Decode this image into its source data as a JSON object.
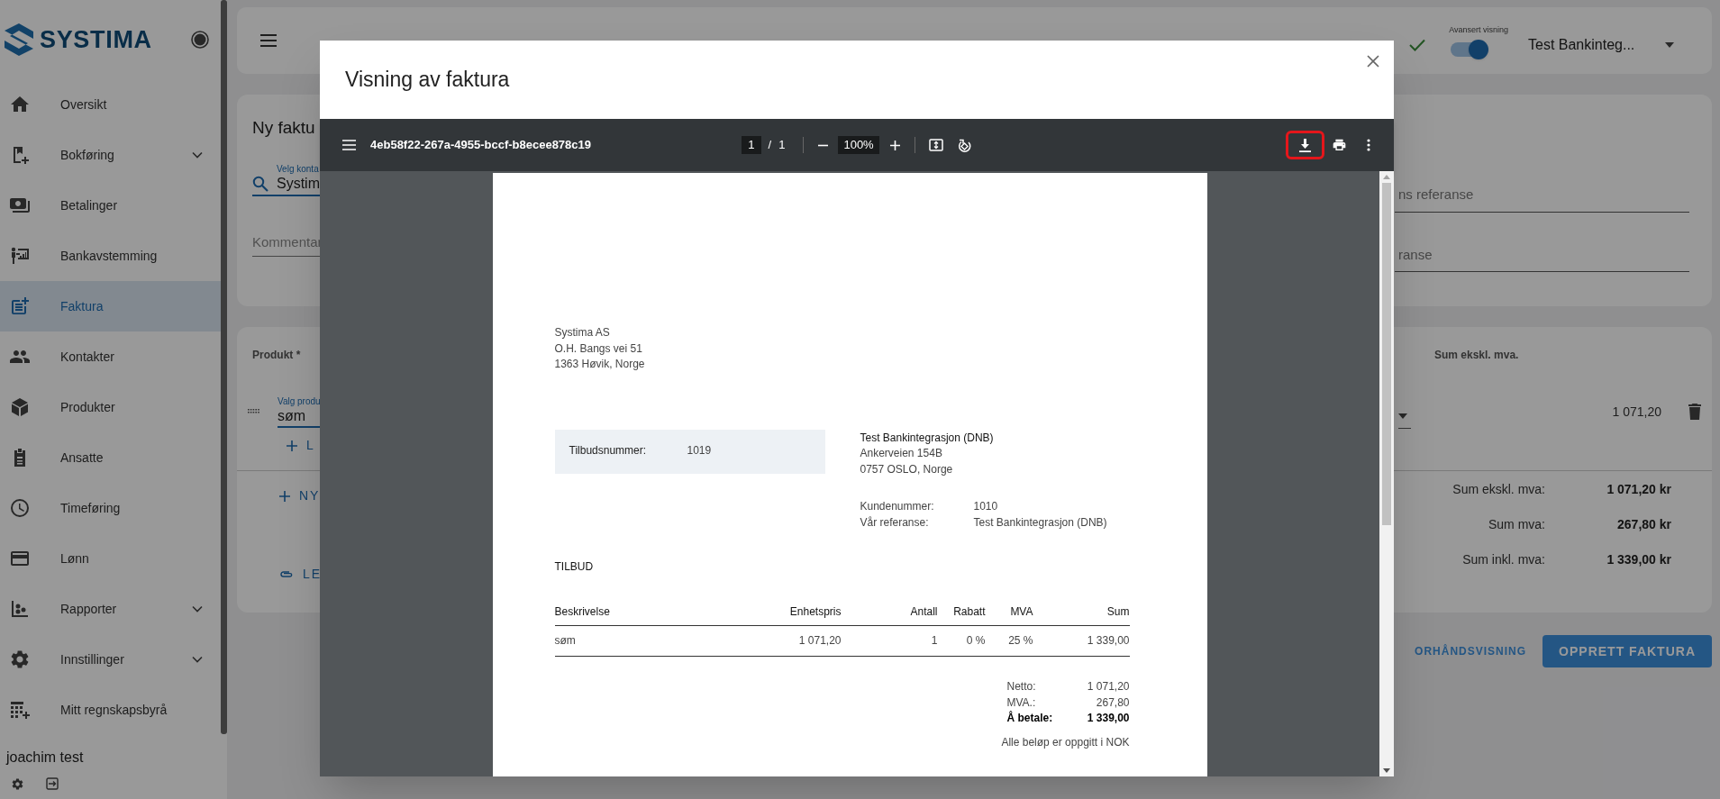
{
  "sidebar": {
    "logo": "SYSTIMA",
    "items": [
      {
        "label": "Oversikt",
        "selected": false,
        "expandable": false
      },
      {
        "label": "Bokføring",
        "selected": false,
        "expandable": true
      },
      {
        "label": "Betalinger",
        "selected": false,
        "expandable": false
      },
      {
        "label": "Bankavstemming",
        "selected": false,
        "expandable": false
      },
      {
        "label": "Faktura",
        "selected": true,
        "expandable": false
      },
      {
        "label": "Kontakter",
        "selected": false,
        "expandable": false
      },
      {
        "label": "Produkter",
        "selected": false,
        "expandable": false
      },
      {
        "label": "Ansatte",
        "selected": false,
        "expandable": false
      },
      {
        "label": "Timeføring",
        "selected": false,
        "expandable": false
      },
      {
        "label": "Lønn",
        "selected": false,
        "expandable": false
      },
      {
        "label": "Rapporter",
        "selected": false,
        "expandable": true
      },
      {
        "label": "Innstillinger",
        "selected": false,
        "expandable": true
      },
      {
        "label": "Mitt regnskapsbyrå",
        "selected": false,
        "expandable": false
      }
    ],
    "user": "joachim test"
  },
  "topbar": {
    "toggle_label": "Avansert visning",
    "toggle_on": true,
    "company": "Test Bankinteg..."
  },
  "invoice_card": {
    "title": "Ny faktu",
    "contact_label": "Velg konta",
    "contact_value": "Systim",
    "comment_placeholder": "Kommentar",
    "right_fields": [
      {
        "placeholder": "ns referanse"
      },
      {
        "placeholder": "ranse"
      }
    ]
  },
  "product_card": {
    "header_left": "Produkt *",
    "header_right": "Sum ekskl. mva.",
    "line": {
      "label": "Valg produ",
      "value": "søm",
      "sum": "1 071,20"
    },
    "add_line": "L",
    "new_line": "NY",
    "attach": "LE",
    "totals": [
      {
        "label": "Sum ekskl. mva:",
        "value": "1 071,20 kr"
      },
      {
        "label": "Sum mva:",
        "value": "267,80 kr"
      },
      {
        "label": "Sum inkl. mva:",
        "value": "1 339,00 kr"
      }
    ]
  },
  "actions": [
    {
      "label": "ORHÅNDSVISNING",
      "kind": "text"
    },
    {
      "label": "OPPRETT FAKTURA",
      "kind": "primary"
    }
  ],
  "modal": {
    "title": "Visning av faktura",
    "viewer": {
      "filename": "4eb58f22-267a-4955-bccf-b8ecee878c19",
      "page": "1",
      "page_separator": "/",
      "page_count": "1",
      "zoom": "100%",
      "download_highlighted": true
    },
    "document": {
      "sender": [
        "Systima AS",
        "O.H. Bangs vei 51",
        "1363 Høvik, Norge"
      ],
      "quote_box": {
        "label": "Tilbudsnummer:",
        "value": "1019"
      },
      "recipient": {
        "name": "Test Bankintegrasjon (DNB)",
        "lines": [
          "Ankerveien 154B",
          "0757 OSLO, Norge"
        ]
      },
      "meta": [
        {
          "label": "Kundenummer:",
          "value": "1010"
        },
        {
          "label": "Vår referanse:",
          "value": "Test Bankintegrasjon (DNB)"
        }
      ],
      "heading": "TILBUD",
      "columns": [
        "Beskrivelse",
        "Enhetspris",
        "Antall",
        "Rabatt",
        "MVA",
        "Sum"
      ],
      "rows": [
        [
          "søm",
          "1 071,20",
          "1",
          "0 %",
          "25 %",
          "1 339,00"
        ]
      ],
      "totals": [
        {
          "label": "Netto:",
          "value": "1 071,20",
          "bold": false
        },
        {
          "label": "MVA.:",
          "value": "267,80",
          "bold": false
        },
        {
          "label": "Å betale:",
          "value": "1 339,00",
          "bold": true
        }
      ],
      "note": "Alle beløp er oppgitt i NOK"
    }
  }
}
